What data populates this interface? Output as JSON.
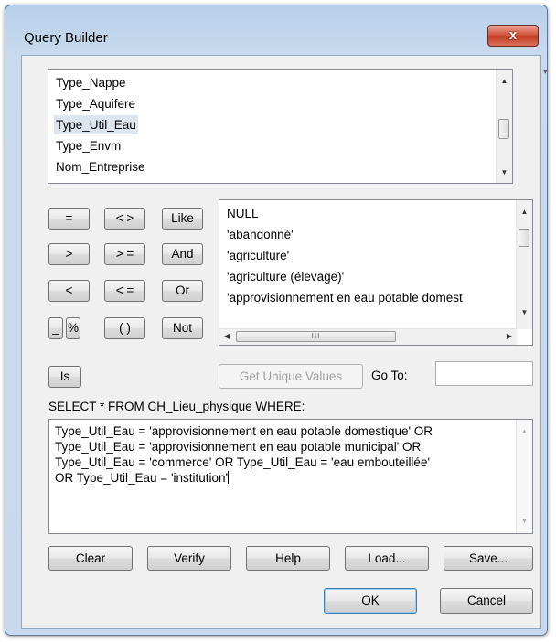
{
  "window": {
    "title": "Query Builder",
    "close_label": "x"
  },
  "fields": {
    "items": [
      "Type_Nappe",
      "Type_Aquifere",
      "Type_Util_Eau",
      "Type_Envm",
      "Nom_Entreprise"
    ],
    "selected_index": 2
  },
  "operators": {
    "eq": "=",
    "ne": "< >",
    "like": "Like",
    "gt": ">",
    "ge": "> =",
    "and": "And",
    "lt": "<",
    "le": "< =",
    "or": "Or",
    "underscore": "_",
    "percent": "%",
    "parens": "( )",
    "not": "Not",
    "is": "Is"
  },
  "values": {
    "items": [
      "NULL",
      "'abandonné'",
      "'agriculture'",
      "'agriculture (élevage)'",
      "'approvisionnement en eau potable domest"
    ],
    "hscroll_grip": "III"
  },
  "unique_values_label": "Get Unique Values",
  "goto": {
    "label": "Go To:",
    "value": ""
  },
  "sql_prefix": "SELECT * FROM CH_Lieu_physique WHERE:",
  "expression": {
    "line1": "Type_Util_Eau = 'approvisionnement en eau potable domestique' OR",
    "line2": "Type_Util_Eau = 'approvisionnement en eau potable municipal' OR",
    "line3": "Type_Util_Eau = 'commerce' OR Type_Util_Eau = 'eau embouteillée'",
    "line4": "OR Type_Util_Eau = 'institution'"
  },
  "buttons": {
    "clear": "Clear",
    "verify": "Verify",
    "help": "Help",
    "load": "Load...",
    "save": "Save...",
    "ok": "OK",
    "cancel": "Cancel"
  }
}
